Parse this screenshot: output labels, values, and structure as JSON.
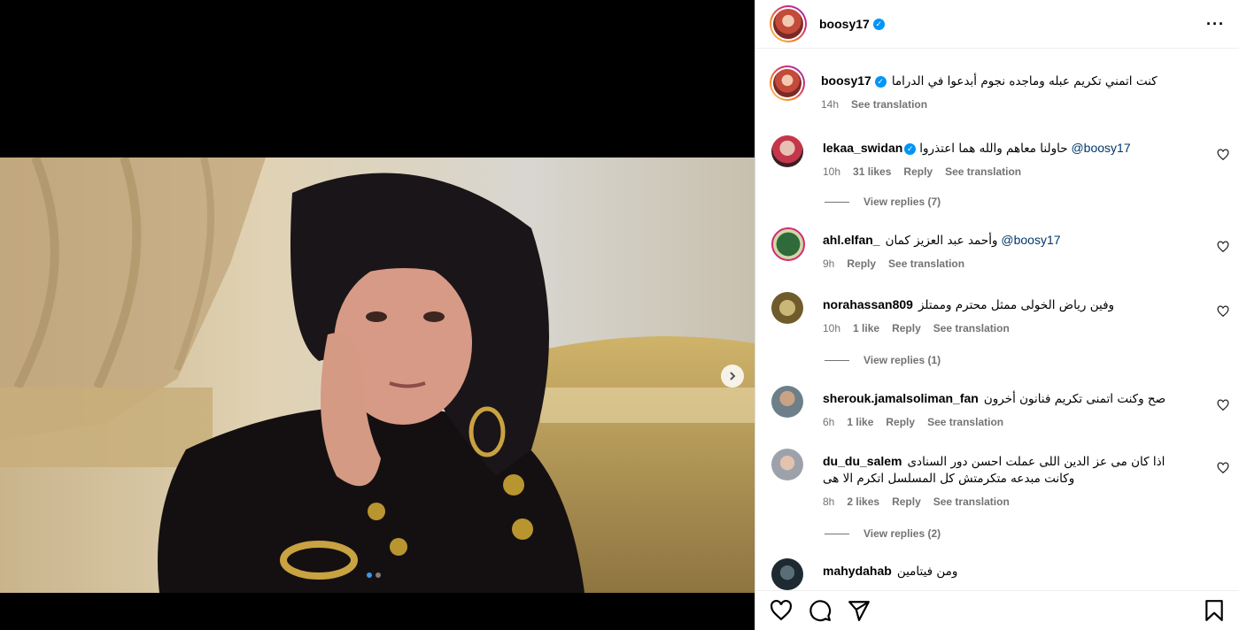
{
  "post": {
    "username": "boosy17",
    "verified": true,
    "caption": "كنت اتمني تكريم عبله وماجده نجوم أبدعوا في الدراما",
    "time": "14h",
    "see_translation": "See translation",
    "carousel": {
      "slides": 2,
      "current": 1
    }
  },
  "comments": [
    {
      "username": "lekaa_swidan",
      "verified": true,
      "mention": "@boosy17",
      "text": "حاولنا معاهم والله هما اعتذروا",
      "time": "10h",
      "likes": "31 likes",
      "reply": "Reply",
      "translate": "See translation",
      "view_replies": "View replies (7)",
      "avatar_color": "#d9a7a0"
    },
    {
      "username": "ahl.elfan_",
      "verified": false,
      "mention": "@boosy17",
      "text": "وأحمد عبد العزيز كمان",
      "time": "9h",
      "likes": "",
      "reply": "Reply",
      "translate": "See translation",
      "view_replies": "",
      "avatar_color": "#6b8e4e"
    },
    {
      "username": "norahassan809",
      "verified": false,
      "mention": "",
      "text": "وفين رياض الخولى ممثل محترم وممتلز",
      "time": "10h",
      "likes": "1 like",
      "reply": "Reply",
      "translate": "See translation",
      "view_replies": "View replies (1)",
      "avatar_color": "#9c8a52"
    },
    {
      "username": "sherouk.jamalsoliman_fan",
      "verified": false,
      "mention": "",
      "text": "صح وكنت اتمنى تكريم فنانون أخرون",
      "time": "6h",
      "likes": "1 like",
      "reply": "Reply",
      "translate": "See translation",
      "view_replies": "",
      "avatar_color": "#7c8d96"
    },
    {
      "username": "du_du_salem",
      "verified": false,
      "mention": "",
      "text": "اذا كان مى عز الدين اللى عملت احسن دور السنادى",
      "text2": "وكانت مبدعه متكرمتش كل المسلسل اتكرم الا هى",
      "time": "8h",
      "likes": "2 likes",
      "reply": "Reply",
      "translate": "See translation",
      "view_replies": "View replies (2)",
      "avatar_color": "#b5b9c0"
    },
    {
      "username": "mahydahab",
      "verified": false,
      "mention": "",
      "text": "ومن فيتامين",
      "avatar_color": "#2c3b44"
    }
  ],
  "actions": {
    "like": "heart-icon",
    "comment": "comment-icon",
    "share": "share-icon",
    "save": "bookmark-icon"
  }
}
